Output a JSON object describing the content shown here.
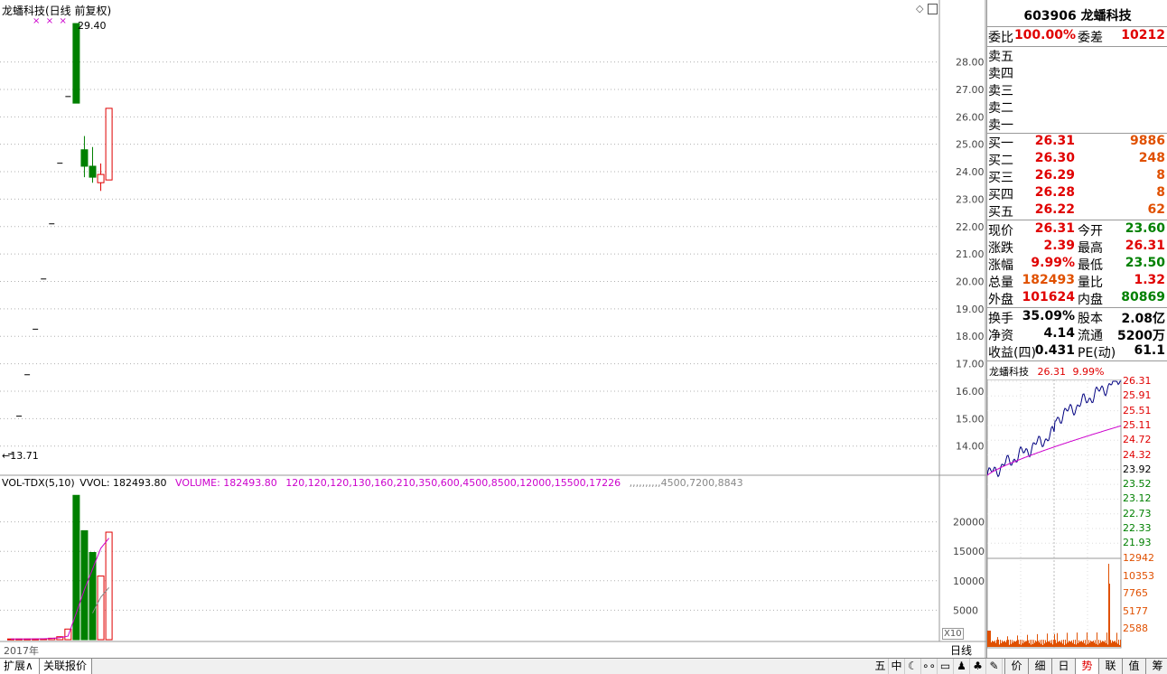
{
  "main_chart": {
    "title": "龙蟠科技(日线 前复权)",
    "high_label": "29.40",
    "low_label": "←13.71",
    "y_ticks": [
      "28.00",
      "27.00",
      "26.00",
      "25.00",
      "24.00",
      "23.00",
      "22.00",
      "21.00",
      "20.00",
      "19.00",
      "18.00",
      "17.00",
      "16.00",
      "15.00",
      "14.00"
    ],
    "candles": [
      {
        "o": 13.71,
        "c": 13.71,
        "h": 13.71,
        "l": 13.71,
        "color": "#000"
      },
      {
        "o": 15.09,
        "c": 15.09,
        "h": 15.09,
        "l": 15.09,
        "color": "#000"
      },
      {
        "o": 16.6,
        "c": 16.6,
        "h": 16.6,
        "l": 16.6,
        "color": "#000"
      },
      {
        "o": 18.26,
        "c": 18.26,
        "h": 18.26,
        "l": 18.26,
        "color": "#000"
      },
      {
        "o": 20.09,
        "c": 20.09,
        "h": 20.09,
        "l": 20.09,
        "color": "#000"
      },
      {
        "o": 22.1,
        "c": 22.1,
        "h": 22.1,
        "l": 22.1,
        "color": "#000"
      },
      {
        "o": 24.31,
        "c": 24.31,
        "h": 24.31,
        "l": 24.31,
        "color": "#000"
      },
      {
        "o": 26.74,
        "c": 26.74,
        "h": 26.74,
        "l": 26.74,
        "color": "#000"
      },
      {
        "o": 29.4,
        "c": 26.5,
        "h": 29.4,
        "l": 26.5,
        "color": "#008000"
      },
      {
        "o": 24.8,
        "c": 24.2,
        "h": 25.3,
        "l": 23.8,
        "color": "#008000"
      },
      {
        "o": 24.2,
        "c": 23.8,
        "h": 24.9,
        "l": 23.6,
        "color": "#008000"
      },
      {
        "o": 23.6,
        "c": 23.9,
        "h": 24.3,
        "l": 23.3,
        "color": "#e00000"
      },
      {
        "o": 23.7,
        "c": 26.31,
        "h": 26.31,
        "l": 23.7,
        "color": "#e00000"
      }
    ],
    "y_range": [
      13.2,
      29.6
    ]
  },
  "vol_chart": {
    "title_label": "VOL-TDX(5,10)",
    "vvol": "VVOL: 182493.80",
    "volume": "VOLUME: 182493.80",
    "mavol1": [
      120,
      120,
      120,
      130,
      160,
      210,
      350,
      600,
      4500,
      8500,
      12000,
      15500,
      17226
    ],
    "mavol2": [
      null,
      null,
      null,
      null,
      null,
      null,
      null,
      null,
      null,
      null,
      4500,
      7200,
      8843
    ],
    "y_ticks": [
      "20000",
      "15000",
      "10000",
      "5000"
    ],
    "scale_label": "X10",
    "x_label": "2017年",
    "vols": [
      120,
      120,
      120,
      120,
      150,
      250,
      500,
      1800,
      24500,
      18500,
      14800,
      10800,
      18249
    ],
    "y_max": 25000
  },
  "quote": {
    "code_name": "603906 龙蟠科技",
    "weibi_label": "委比",
    "weibi_value": "100.00%",
    "weicha_label": "委差",
    "weicha_value": "10212",
    "sell": [
      {
        "label": "卖五"
      },
      {
        "label": "卖四"
      },
      {
        "label": "卖三"
      },
      {
        "label": "卖二"
      },
      {
        "label": "卖一"
      }
    ],
    "buy": [
      {
        "label": "买一",
        "price": "26.31",
        "vol": "9886"
      },
      {
        "label": "买二",
        "price": "26.30",
        "vol": "248"
      },
      {
        "label": "买三",
        "price": "26.29",
        "vol": "8"
      },
      {
        "label": "买四",
        "price": "26.28",
        "vol": "8"
      },
      {
        "label": "买五",
        "price": "26.22",
        "vol": "62"
      }
    ],
    "stats": [
      {
        "l1": "现价",
        "v1": "26.31",
        "c1": "red",
        "l2": "今开",
        "v2": "23.60",
        "c2": "green"
      },
      {
        "l1": "涨跌",
        "v1": "2.39",
        "c1": "red",
        "l2": "最高",
        "v2": "26.31",
        "c2": "red"
      },
      {
        "l1": "涨幅",
        "v1": "9.99%",
        "c1": "red",
        "l2": "最低",
        "v2": "23.50",
        "c2": "green"
      },
      {
        "l1": "总量",
        "v1": "182493",
        "c1": "orange",
        "l2": "量比",
        "v2": "1.32",
        "c2": "red"
      },
      {
        "l1": "外盘",
        "v1": "101624",
        "c1": "red",
        "l2": "内盘",
        "v2": "80869",
        "c2": "green"
      }
    ],
    "fund": [
      {
        "l1": "换手",
        "v1": "35.09%",
        "l2": "股本",
        "v2": "2.08亿"
      },
      {
        "l1": "净资",
        "v1": "4.14",
        "l2": "流通",
        "v2": "5200万"
      },
      {
        "l1": "收益(四)",
        "v1": "0.431",
        "l2": "PE(动)",
        "v2": "61.1"
      }
    ]
  },
  "intraday": {
    "name": "龙蟠科技",
    "price": "26.31",
    "pct": "9.99%",
    "price_ticks": [
      "26.31",
      "25.91",
      "25.51",
      "25.11",
      "24.72",
      "24.32",
      "23.92",
      "23.52",
      "23.12",
      "22.73",
      "22.33",
      "21.93"
    ],
    "vol_ticks": [
      "12942",
      "10353",
      "7765",
      "5177",
      "2588"
    ]
  },
  "bottom": {
    "tab1": "扩展∧",
    "tab2": "关联报价",
    "daily_label": "日线",
    "tool_icons": [
      "五",
      "中",
      "☾",
      "∘∘",
      "▭",
      "♟",
      "♣",
      "✎"
    ],
    "right_tabs": [
      "价",
      "细",
      "日",
      "势",
      "联",
      "值",
      "筹"
    ],
    "active_tab": "势"
  },
  "colors": {
    "up": "#e00000",
    "down": "#008000",
    "ma": "#cc00cc",
    "price_line": "#000080"
  }
}
